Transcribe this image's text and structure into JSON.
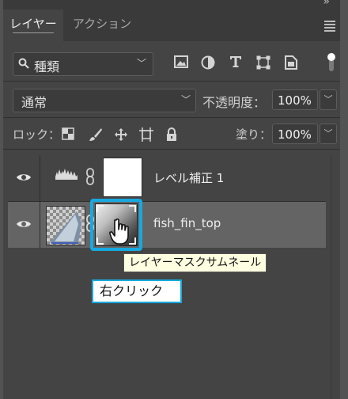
{
  "tabs": [
    {
      "label": "レイヤー",
      "active": true
    },
    {
      "label": "アクション",
      "active": false
    }
  ],
  "filter": {
    "kind_label": "種類",
    "icons": [
      "image-filter-icon",
      "adjustment-filter-icon",
      "type-filter-icon",
      "shape-filter-icon",
      "smart-object-filter-icon"
    ]
  },
  "blend": {
    "mode": "通常",
    "opacity_label": "不透明度：",
    "opacity_value": "100%"
  },
  "lock": {
    "label": "ロック：",
    "fill_label": "塗り：",
    "fill_value": "100%"
  },
  "layers": [
    {
      "name": "レベル補正 1",
      "type": "adjustment",
      "visible": true
    },
    {
      "name": "fish_fin_top",
      "type": "pixel",
      "visible": true,
      "selected": true
    }
  ],
  "tooltip": "レイヤーマスクサムネール",
  "callout": "右クリック",
  "colors": {
    "highlight": "#17a9e1",
    "panel": "#444444",
    "selected_row": "#646464"
  }
}
